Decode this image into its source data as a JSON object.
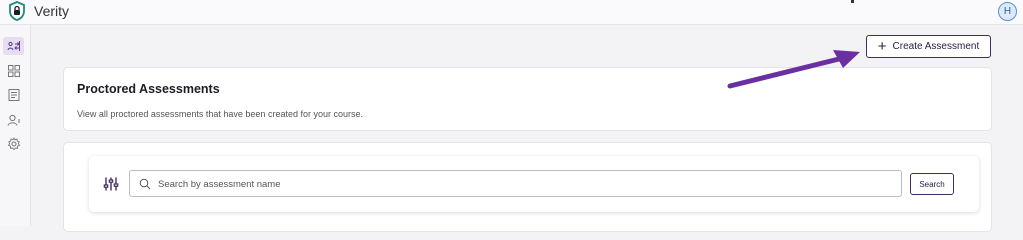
{
  "app": {
    "name": "Verity",
    "user_initial": "H"
  },
  "sidebar": {
    "items": [
      {
        "icon": "assessment-swap-icon",
        "active": true
      },
      {
        "icon": "grid-icon",
        "active": false
      },
      {
        "icon": "document-icon",
        "active": false
      },
      {
        "icon": "users-icon",
        "active": false
      },
      {
        "icon": "gear-icon",
        "active": false
      }
    ]
  },
  "header": {
    "create_label": "Create Assessment"
  },
  "intro_card": {
    "title": "Proctored Assessments",
    "description": "View all proctored assessments that have been created for your course."
  },
  "search": {
    "placeholder": "Search by assessment name",
    "value": "",
    "button_label": "Search"
  },
  "colors": {
    "accent": "#3f2d63",
    "annotation_arrow": "#6a2fa0",
    "sidebar_active": "#e6ddf2"
  }
}
